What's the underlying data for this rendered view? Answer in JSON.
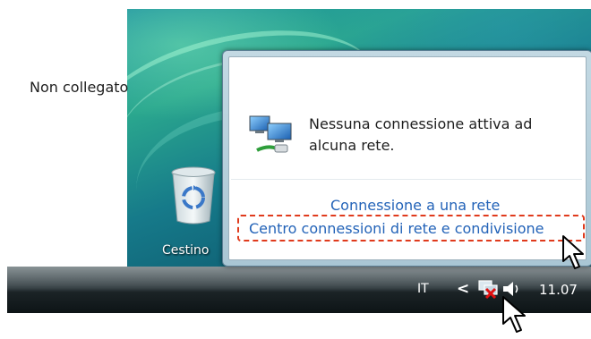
{
  "desktop": {
    "recycle_bin_label": "Cestino"
  },
  "popup": {
    "status_title": "Non collegato",
    "message": "Nessuna connessione attiva ad alcuna rete.",
    "link_connect": "Connessione a una rete",
    "link_network_center": "Centro connessioni di rete e condivisione"
  },
  "taskbar": {
    "language": "IT",
    "show_hidden_glyph": "<",
    "clock": "11.07"
  },
  "icons": {
    "network_disconnected": "network-disconnected-icon",
    "volume": "volume-icon",
    "recycle_bin": "recycle-bin-icon",
    "cursor": "arrow-cursor-icon"
  },
  "colors": {
    "link": "#2363b8",
    "highlight": "#e03a1c",
    "taskbar": "#1b2326"
  }
}
